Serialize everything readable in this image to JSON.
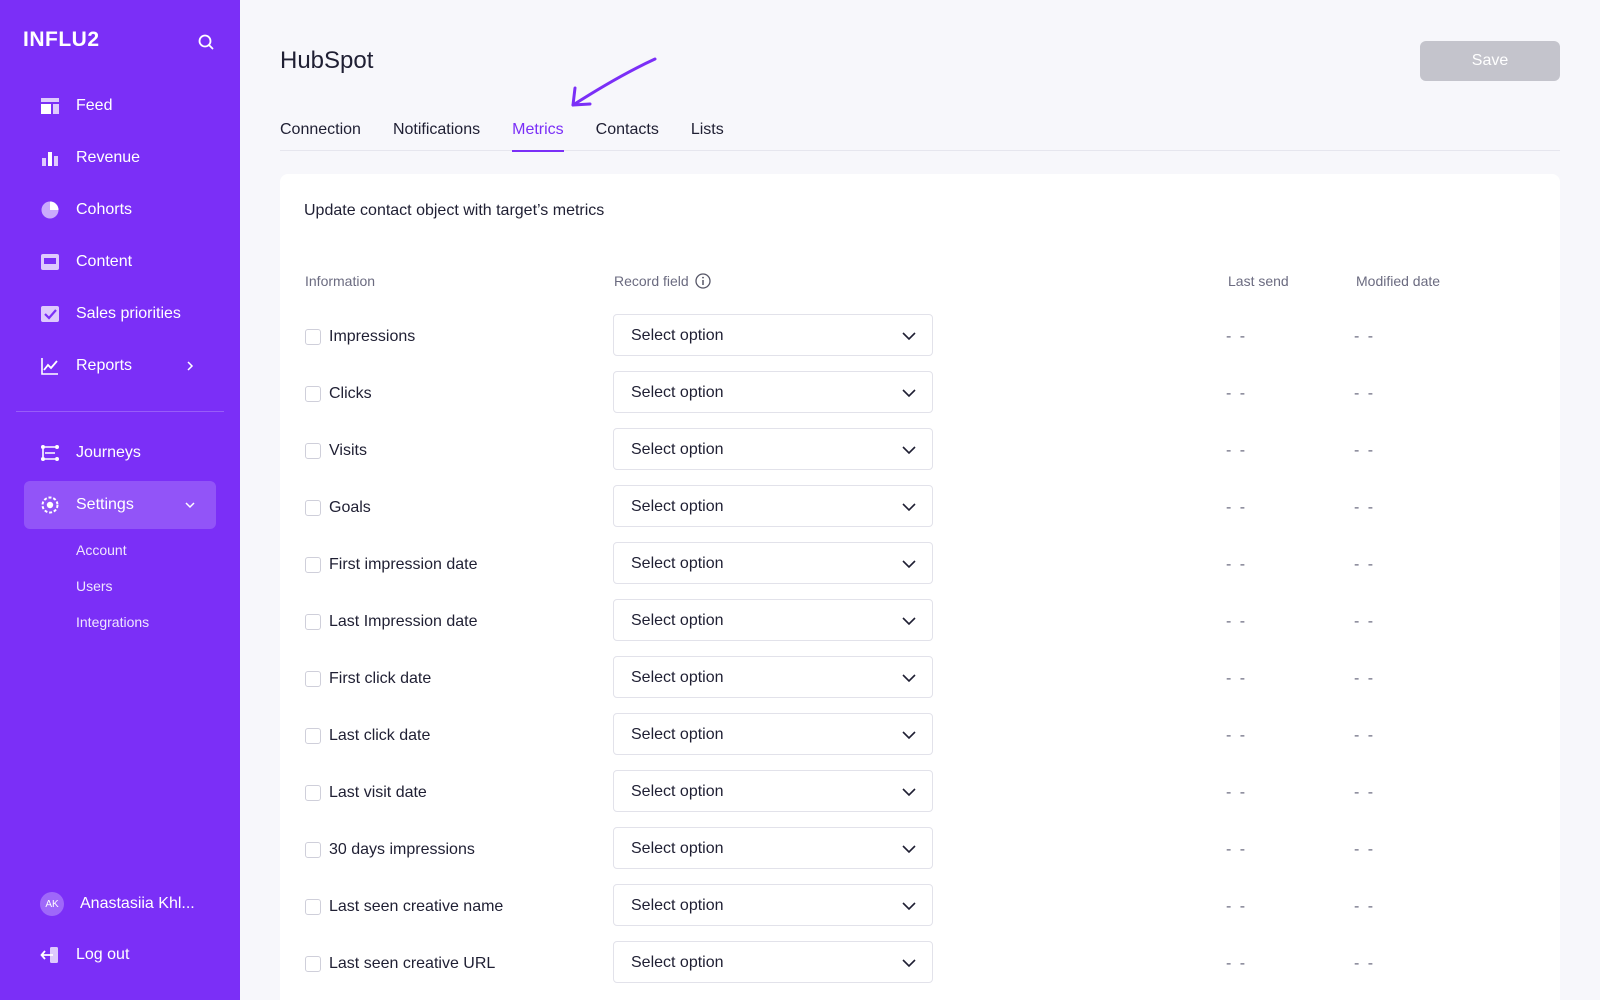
{
  "sidebar": {
    "logo": "INFLU2",
    "nav": [
      {
        "label": "Feed",
        "icon": "feed-icon"
      },
      {
        "label": "Revenue",
        "icon": "bar-chart-icon"
      },
      {
        "label": "Cohorts",
        "icon": "pie-chart-icon"
      },
      {
        "label": "Content",
        "icon": "content-icon"
      },
      {
        "label": "Sales priorities",
        "icon": "checkbox-icon"
      },
      {
        "label": "Reports",
        "icon": "line-chart-icon"
      }
    ],
    "nav2": [
      {
        "label": "Journeys",
        "icon": "journeys-icon"
      },
      {
        "label": "Settings",
        "icon": "gear-icon"
      }
    ],
    "settings_sub": [
      "Account",
      "Users",
      "Integrations"
    ],
    "user": {
      "initials": "AK",
      "name": "Anastasiia Khl..."
    },
    "logout": "Log out"
  },
  "header": {
    "title": "HubSpot",
    "save_label": "Save"
  },
  "tabs": [
    {
      "label": "Connection",
      "active": false
    },
    {
      "label": "Notifications",
      "active": false
    },
    {
      "label": "Metrics",
      "active": true
    },
    {
      "label": "Contacts",
      "active": false
    },
    {
      "label": "Lists",
      "active": false
    }
  ],
  "card": {
    "title": "Update contact object with target’s metrics",
    "columns": {
      "information": "Information",
      "record_field": "Record field",
      "last_send": "Last send",
      "modified_date": "Modified date"
    },
    "rows": [
      {
        "label": "Impressions",
        "select": "Select option",
        "last_send": "- -",
        "modified": "- -"
      },
      {
        "label": "Clicks",
        "select": "Select option",
        "last_send": "- -",
        "modified": "- -"
      },
      {
        "label": "Visits",
        "select": "Select option",
        "last_send": "- -",
        "modified": "- -"
      },
      {
        "label": "Goals",
        "select": "Select option",
        "last_send": "- -",
        "modified": "- -"
      },
      {
        "label": "First impression date",
        "select": "Select option",
        "last_send": "- -",
        "modified": "- -"
      },
      {
        "label": "Last Impression date",
        "select": "Select option",
        "last_send": "- -",
        "modified": "- -"
      },
      {
        "label": "First click date",
        "select": "Select option",
        "last_send": "- -",
        "modified": "- -"
      },
      {
        "label": "Last click date",
        "select": "Select option",
        "last_send": "- -",
        "modified": "- -"
      },
      {
        "label": "Last visit date",
        "select": "Select option",
        "last_send": "- -",
        "modified": "- -"
      },
      {
        "label": "30 days impressions",
        "select": "Select option",
        "last_send": "- -",
        "modified": "- -"
      },
      {
        "label": "Last seen creative name",
        "select": "Select option",
        "last_send": "- -",
        "modified": "- -"
      },
      {
        "label": "Last seen creative URL",
        "select": "Select option",
        "last_send": "- -",
        "modified": "- -"
      }
    ]
  },
  "colors": {
    "brand": "#7b2ff7",
    "save_disabled": "#c4c4cc"
  }
}
